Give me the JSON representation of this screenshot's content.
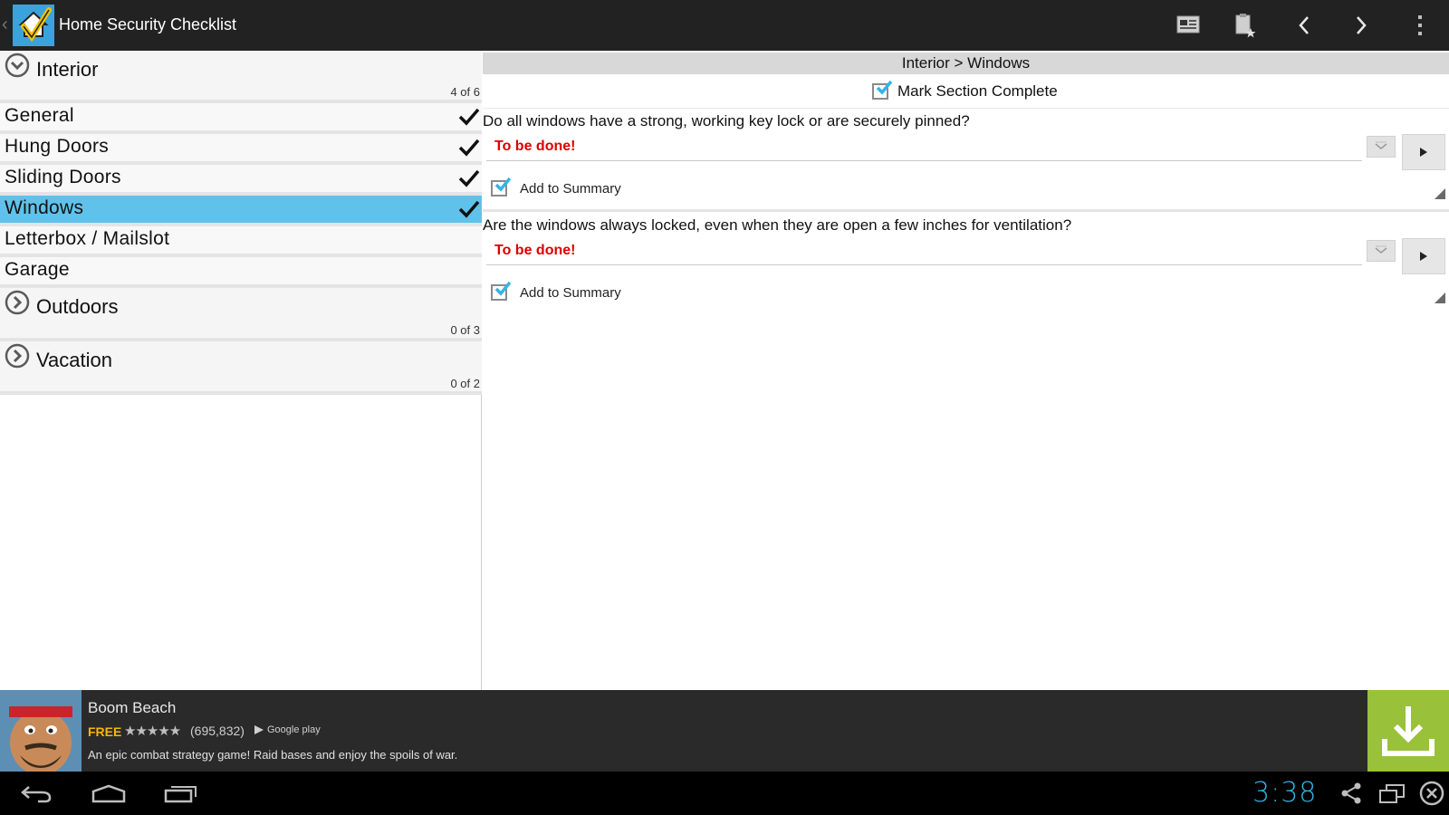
{
  "actionbar": {
    "title": "Home Security Checklist",
    "icons": [
      "app-logo-icon",
      "report-icon",
      "clipboard-star-icon",
      "previous-icon",
      "next-icon",
      "overflow-menu-icon"
    ]
  },
  "sidebar": {
    "groups": [
      {
        "title": "Interior",
        "count": "4 of 6",
        "expanded": true
      },
      {
        "title": "Outdoors",
        "count": "0 of 3",
        "expanded": false
      },
      {
        "title": "Vacation",
        "count": "0 of 2",
        "expanded": false
      }
    ],
    "items": [
      {
        "label": "General",
        "done": true
      },
      {
        "label": "Hung Doors",
        "done": true
      },
      {
        "label": "Sliding Doors",
        "done": true
      },
      {
        "label": "Windows",
        "done": true,
        "selected": true
      },
      {
        "label": "Letterbox / Mailslot",
        "done": false
      },
      {
        "label": "Garage",
        "done": false
      }
    ],
    "selected_color": "#60c2ea"
  },
  "main": {
    "breadcrumb": "Interior > Windows",
    "mark_complete_label": "Mark Section Complete",
    "mark_complete_checked": true,
    "questions": [
      {
        "text": "Do all windows have a strong, working key lock or are securely pinned?",
        "answer": "To be done!",
        "summary_label": "Add to Summary",
        "summary_checked": true
      },
      {
        "text": "Are the windows always locked, even when they are open a few inches for ventilation?",
        "answer": "To be done!",
        "summary_label": "Add to Summary",
        "summary_checked": true
      }
    ],
    "answer_color": "#dd0000",
    "accent": "#33b5e5"
  },
  "ad": {
    "title": "Boom Beach",
    "price": "FREE",
    "stars": "★★★★★",
    "rating_count": "(695,832)",
    "store": "Google play",
    "description": "An epic combat strategy game! Raid bases and enjoy the spoils of war.",
    "download_color": "#9ac13a"
  },
  "navbar": {
    "time": "3:38",
    "icons": [
      "back-icon",
      "home-icon",
      "recent-apps-icon",
      "share-icon",
      "window-icon",
      "close-icon"
    ]
  }
}
